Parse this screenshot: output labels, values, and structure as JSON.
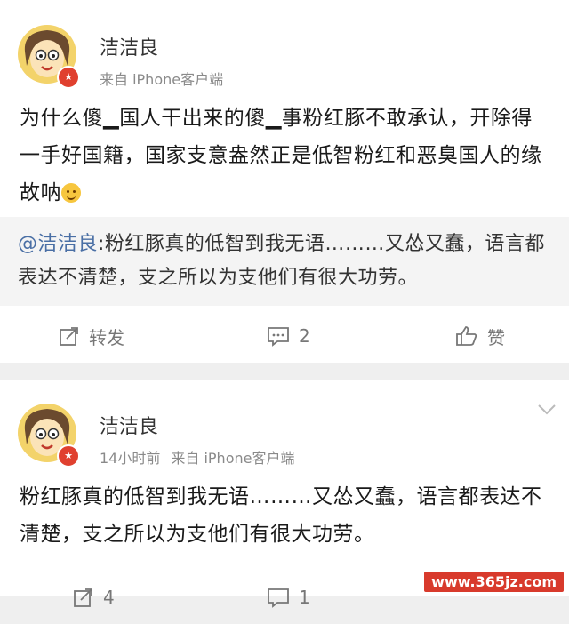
{
  "post1": {
    "author": "洁洁良",
    "source": "来自 iPhone客户端",
    "text": "为什么傻▁国人干出来的傻▁事粉红豚不敢承认，开除得一手好国籍，国家支意盎然正是低智粉红和恶臭国人的缘故呐",
    "quote": {
      "mention": "@洁洁良",
      "text": ":粉红豚真的低智到我无语………又怂又蠢，语言都表达不清楚，支之所以为支他们有很大功劳。"
    },
    "actions": {
      "repost_label": "转发",
      "comment_count": "2",
      "like_label": "赞"
    }
  },
  "post2": {
    "author": "洁洁良",
    "time": "14小时前",
    "source": "来自 iPhone客户端",
    "text": "粉红豚真的低智到我无语………又怂又蠢，语言都表达不清楚，支之所以为支他们有很大功劳。",
    "actions": {
      "repost_count": "4",
      "comment_count": "1"
    }
  },
  "watermark": "www.365jz.com",
  "colors": {
    "badge": "#e0402f",
    "mention": "#4a6fa5",
    "watermark_bg": "#d83a2c"
  }
}
